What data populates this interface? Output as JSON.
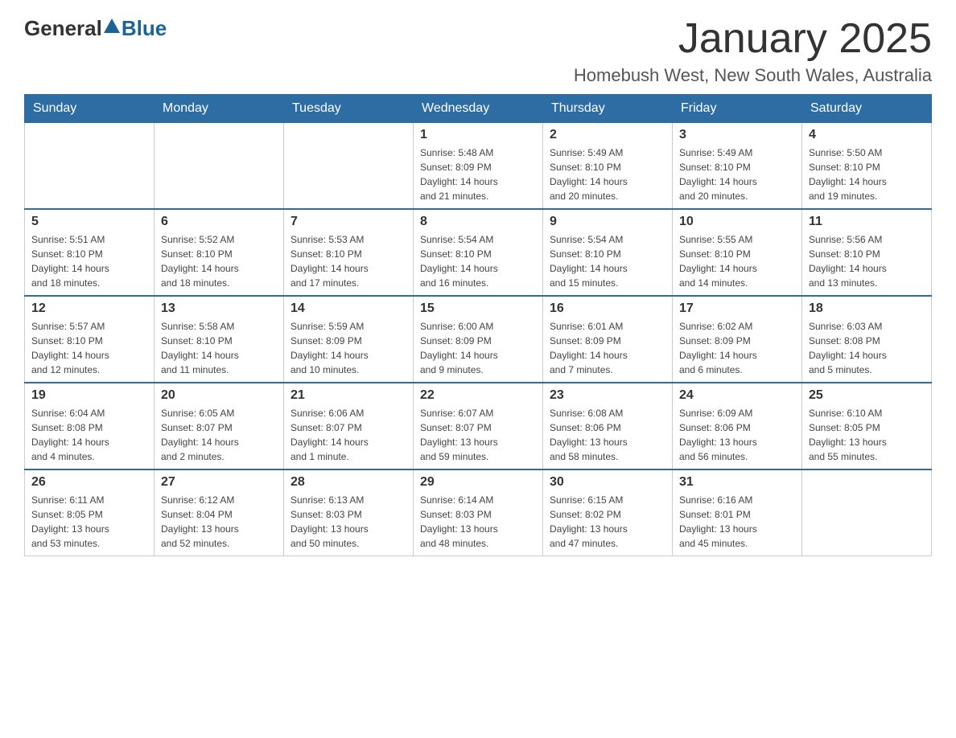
{
  "logo": {
    "general": "General",
    "blue": "Blue"
  },
  "title": "January 2025",
  "subtitle": "Homebush West, New South Wales, Australia",
  "days_of_week": [
    "Sunday",
    "Monday",
    "Tuesday",
    "Wednesday",
    "Thursday",
    "Friday",
    "Saturday"
  ],
  "weeks": [
    {
      "days": [
        {
          "num": "",
          "info": ""
        },
        {
          "num": "",
          "info": ""
        },
        {
          "num": "",
          "info": ""
        },
        {
          "num": "1",
          "info": "Sunrise: 5:48 AM\nSunset: 8:09 PM\nDaylight: 14 hours\nand 21 minutes."
        },
        {
          "num": "2",
          "info": "Sunrise: 5:49 AM\nSunset: 8:10 PM\nDaylight: 14 hours\nand 20 minutes."
        },
        {
          "num": "3",
          "info": "Sunrise: 5:49 AM\nSunset: 8:10 PM\nDaylight: 14 hours\nand 20 minutes."
        },
        {
          "num": "4",
          "info": "Sunrise: 5:50 AM\nSunset: 8:10 PM\nDaylight: 14 hours\nand 19 minutes."
        }
      ]
    },
    {
      "days": [
        {
          "num": "5",
          "info": "Sunrise: 5:51 AM\nSunset: 8:10 PM\nDaylight: 14 hours\nand 18 minutes."
        },
        {
          "num": "6",
          "info": "Sunrise: 5:52 AM\nSunset: 8:10 PM\nDaylight: 14 hours\nand 18 minutes."
        },
        {
          "num": "7",
          "info": "Sunrise: 5:53 AM\nSunset: 8:10 PM\nDaylight: 14 hours\nand 17 minutes."
        },
        {
          "num": "8",
          "info": "Sunrise: 5:54 AM\nSunset: 8:10 PM\nDaylight: 14 hours\nand 16 minutes."
        },
        {
          "num": "9",
          "info": "Sunrise: 5:54 AM\nSunset: 8:10 PM\nDaylight: 14 hours\nand 15 minutes."
        },
        {
          "num": "10",
          "info": "Sunrise: 5:55 AM\nSunset: 8:10 PM\nDaylight: 14 hours\nand 14 minutes."
        },
        {
          "num": "11",
          "info": "Sunrise: 5:56 AM\nSunset: 8:10 PM\nDaylight: 14 hours\nand 13 minutes."
        }
      ]
    },
    {
      "days": [
        {
          "num": "12",
          "info": "Sunrise: 5:57 AM\nSunset: 8:10 PM\nDaylight: 14 hours\nand 12 minutes."
        },
        {
          "num": "13",
          "info": "Sunrise: 5:58 AM\nSunset: 8:10 PM\nDaylight: 14 hours\nand 11 minutes."
        },
        {
          "num": "14",
          "info": "Sunrise: 5:59 AM\nSunset: 8:09 PM\nDaylight: 14 hours\nand 10 minutes."
        },
        {
          "num": "15",
          "info": "Sunrise: 6:00 AM\nSunset: 8:09 PM\nDaylight: 14 hours\nand 9 minutes."
        },
        {
          "num": "16",
          "info": "Sunrise: 6:01 AM\nSunset: 8:09 PM\nDaylight: 14 hours\nand 7 minutes."
        },
        {
          "num": "17",
          "info": "Sunrise: 6:02 AM\nSunset: 8:09 PM\nDaylight: 14 hours\nand 6 minutes."
        },
        {
          "num": "18",
          "info": "Sunrise: 6:03 AM\nSunset: 8:08 PM\nDaylight: 14 hours\nand 5 minutes."
        }
      ]
    },
    {
      "days": [
        {
          "num": "19",
          "info": "Sunrise: 6:04 AM\nSunset: 8:08 PM\nDaylight: 14 hours\nand 4 minutes."
        },
        {
          "num": "20",
          "info": "Sunrise: 6:05 AM\nSunset: 8:07 PM\nDaylight: 14 hours\nand 2 minutes."
        },
        {
          "num": "21",
          "info": "Sunrise: 6:06 AM\nSunset: 8:07 PM\nDaylight: 14 hours\nand 1 minute."
        },
        {
          "num": "22",
          "info": "Sunrise: 6:07 AM\nSunset: 8:07 PM\nDaylight: 13 hours\nand 59 minutes."
        },
        {
          "num": "23",
          "info": "Sunrise: 6:08 AM\nSunset: 8:06 PM\nDaylight: 13 hours\nand 58 minutes."
        },
        {
          "num": "24",
          "info": "Sunrise: 6:09 AM\nSunset: 8:06 PM\nDaylight: 13 hours\nand 56 minutes."
        },
        {
          "num": "25",
          "info": "Sunrise: 6:10 AM\nSunset: 8:05 PM\nDaylight: 13 hours\nand 55 minutes."
        }
      ]
    },
    {
      "days": [
        {
          "num": "26",
          "info": "Sunrise: 6:11 AM\nSunset: 8:05 PM\nDaylight: 13 hours\nand 53 minutes."
        },
        {
          "num": "27",
          "info": "Sunrise: 6:12 AM\nSunset: 8:04 PM\nDaylight: 13 hours\nand 52 minutes."
        },
        {
          "num": "28",
          "info": "Sunrise: 6:13 AM\nSunset: 8:03 PM\nDaylight: 13 hours\nand 50 minutes."
        },
        {
          "num": "29",
          "info": "Sunrise: 6:14 AM\nSunset: 8:03 PM\nDaylight: 13 hours\nand 48 minutes."
        },
        {
          "num": "30",
          "info": "Sunrise: 6:15 AM\nSunset: 8:02 PM\nDaylight: 13 hours\nand 47 minutes."
        },
        {
          "num": "31",
          "info": "Sunrise: 6:16 AM\nSunset: 8:01 PM\nDaylight: 13 hours\nand 45 minutes."
        },
        {
          "num": "",
          "info": ""
        }
      ]
    }
  ]
}
